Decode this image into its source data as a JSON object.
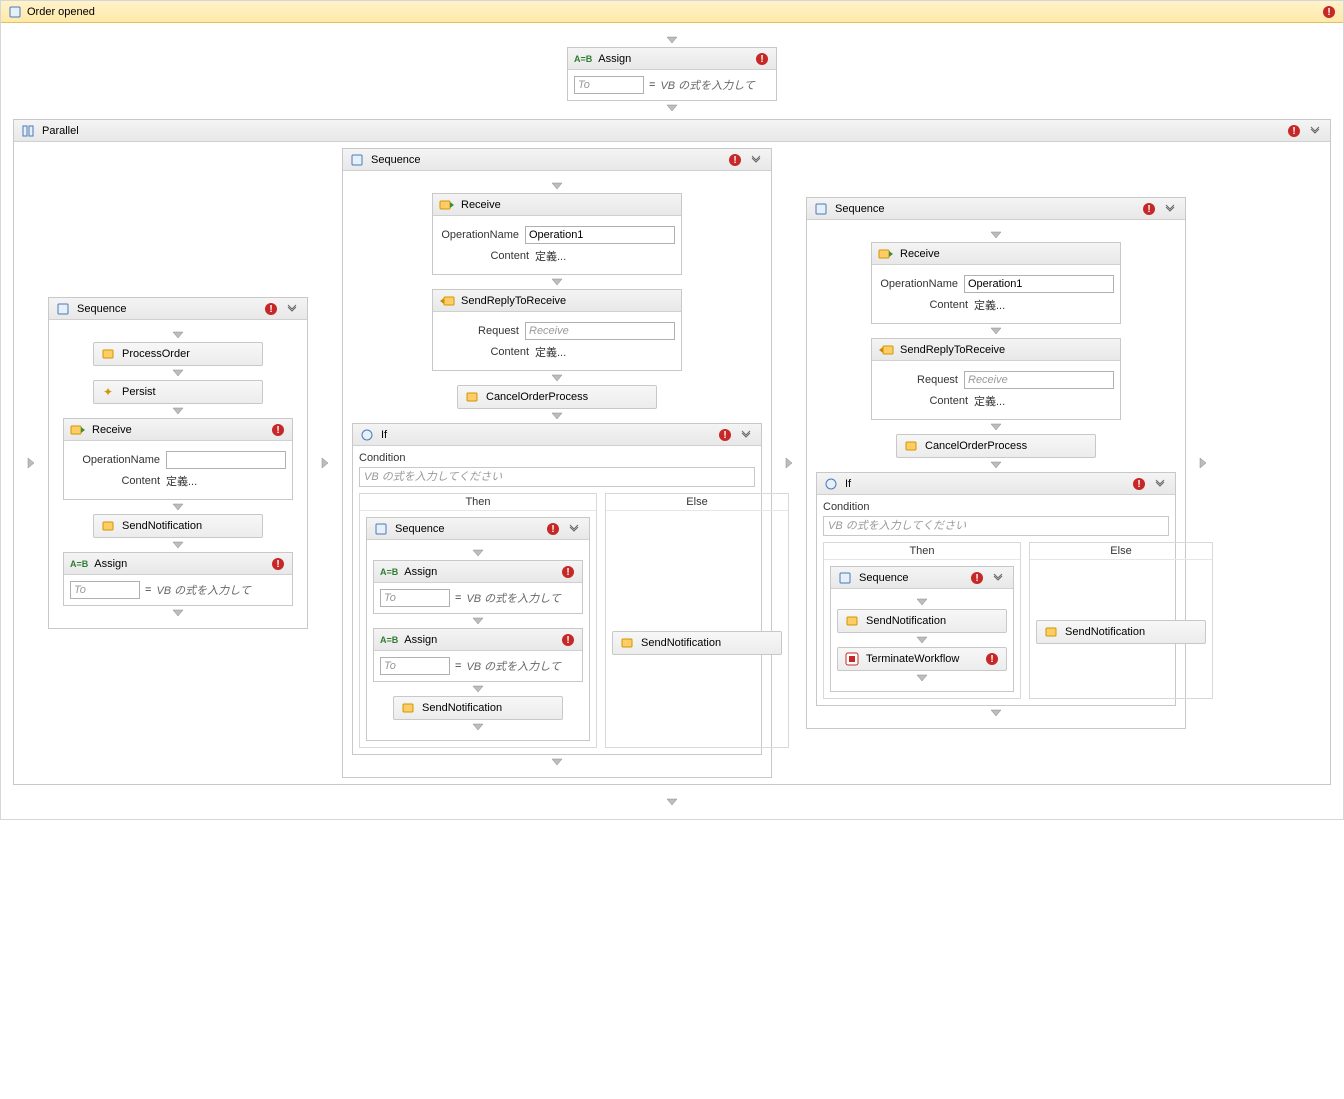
{
  "header": {
    "title": "Order opened"
  },
  "assign_top": {
    "label": "Assign",
    "to_ph": "To",
    "expr": "VB の式を入力して"
  },
  "parallel": {
    "label": "Parallel"
  },
  "lane1": {
    "seq": "Sequence",
    "process_order": "ProcessOrder",
    "persist": "Persist",
    "receive": {
      "label": "Receive",
      "opname_lbl": "OperationName",
      "opname_val": "",
      "content_lbl": "Content",
      "content_val": "定義..."
    },
    "send_notif": "SendNotification",
    "assign": {
      "label": "Assign",
      "to_ph": "To",
      "expr": "VB の式を入力して"
    }
  },
  "lane2": {
    "seq": "Sequence",
    "receive": {
      "label": "Receive",
      "opname_lbl": "OperationName",
      "opname_val": "Operation1",
      "content_lbl": "Content",
      "content_val": "定義..."
    },
    "sendreply": {
      "label": "SendReplyToReceive",
      "request_lbl": "Request",
      "request_ph": "Receive",
      "content_lbl": "Content",
      "content_val": "定義..."
    },
    "cancel": "CancelOrderProcess",
    "if": {
      "label": "If",
      "cond_lbl": "Condition",
      "cond_ph": "VB の式を入力してください",
      "then": "Then",
      "else": "Else"
    },
    "then_seq": "Sequence",
    "assign1": {
      "label": "Assign",
      "to_ph": "To",
      "expr": "VB の式を入力して"
    },
    "assign2": {
      "label": "Assign",
      "to_ph": "To",
      "expr": "VB の式を入力して"
    },
    "then_sendnotif": "SendNotification",
    "else_sendnotif": "SendNotification"
  },
  "lane3": {
    "seq": "Sequence",
    "receive": {
      "label": "Receive",
      "opname_lbl": "OperationName",
      "opname_val": "Operation1",
      "content_lbl": "Content",
      "content_val": "定義..."
    },
    "sendreply": {
      "label": "SendReplyToReceive",
      "request_lbl": "Request",
      "request_ph": "Receive",
      "content_lbl": "Content",
      "content_val": "定義..."
    },
    "cancel": "CancelOrderProcess",
    "if": {
      "label": "If",
      "cond_lbl": "Condition",
      "cond_ph": "VB の式を入力してください",
      "then": "Then",
      "else": "Else"
    },
    "then_seq": "Sequence",
    "then_sendnotif": "SendNotification",
    "terminate": "TerminateWorkflow",
    "else_sendnotif": "SendNotification"
  }
}
